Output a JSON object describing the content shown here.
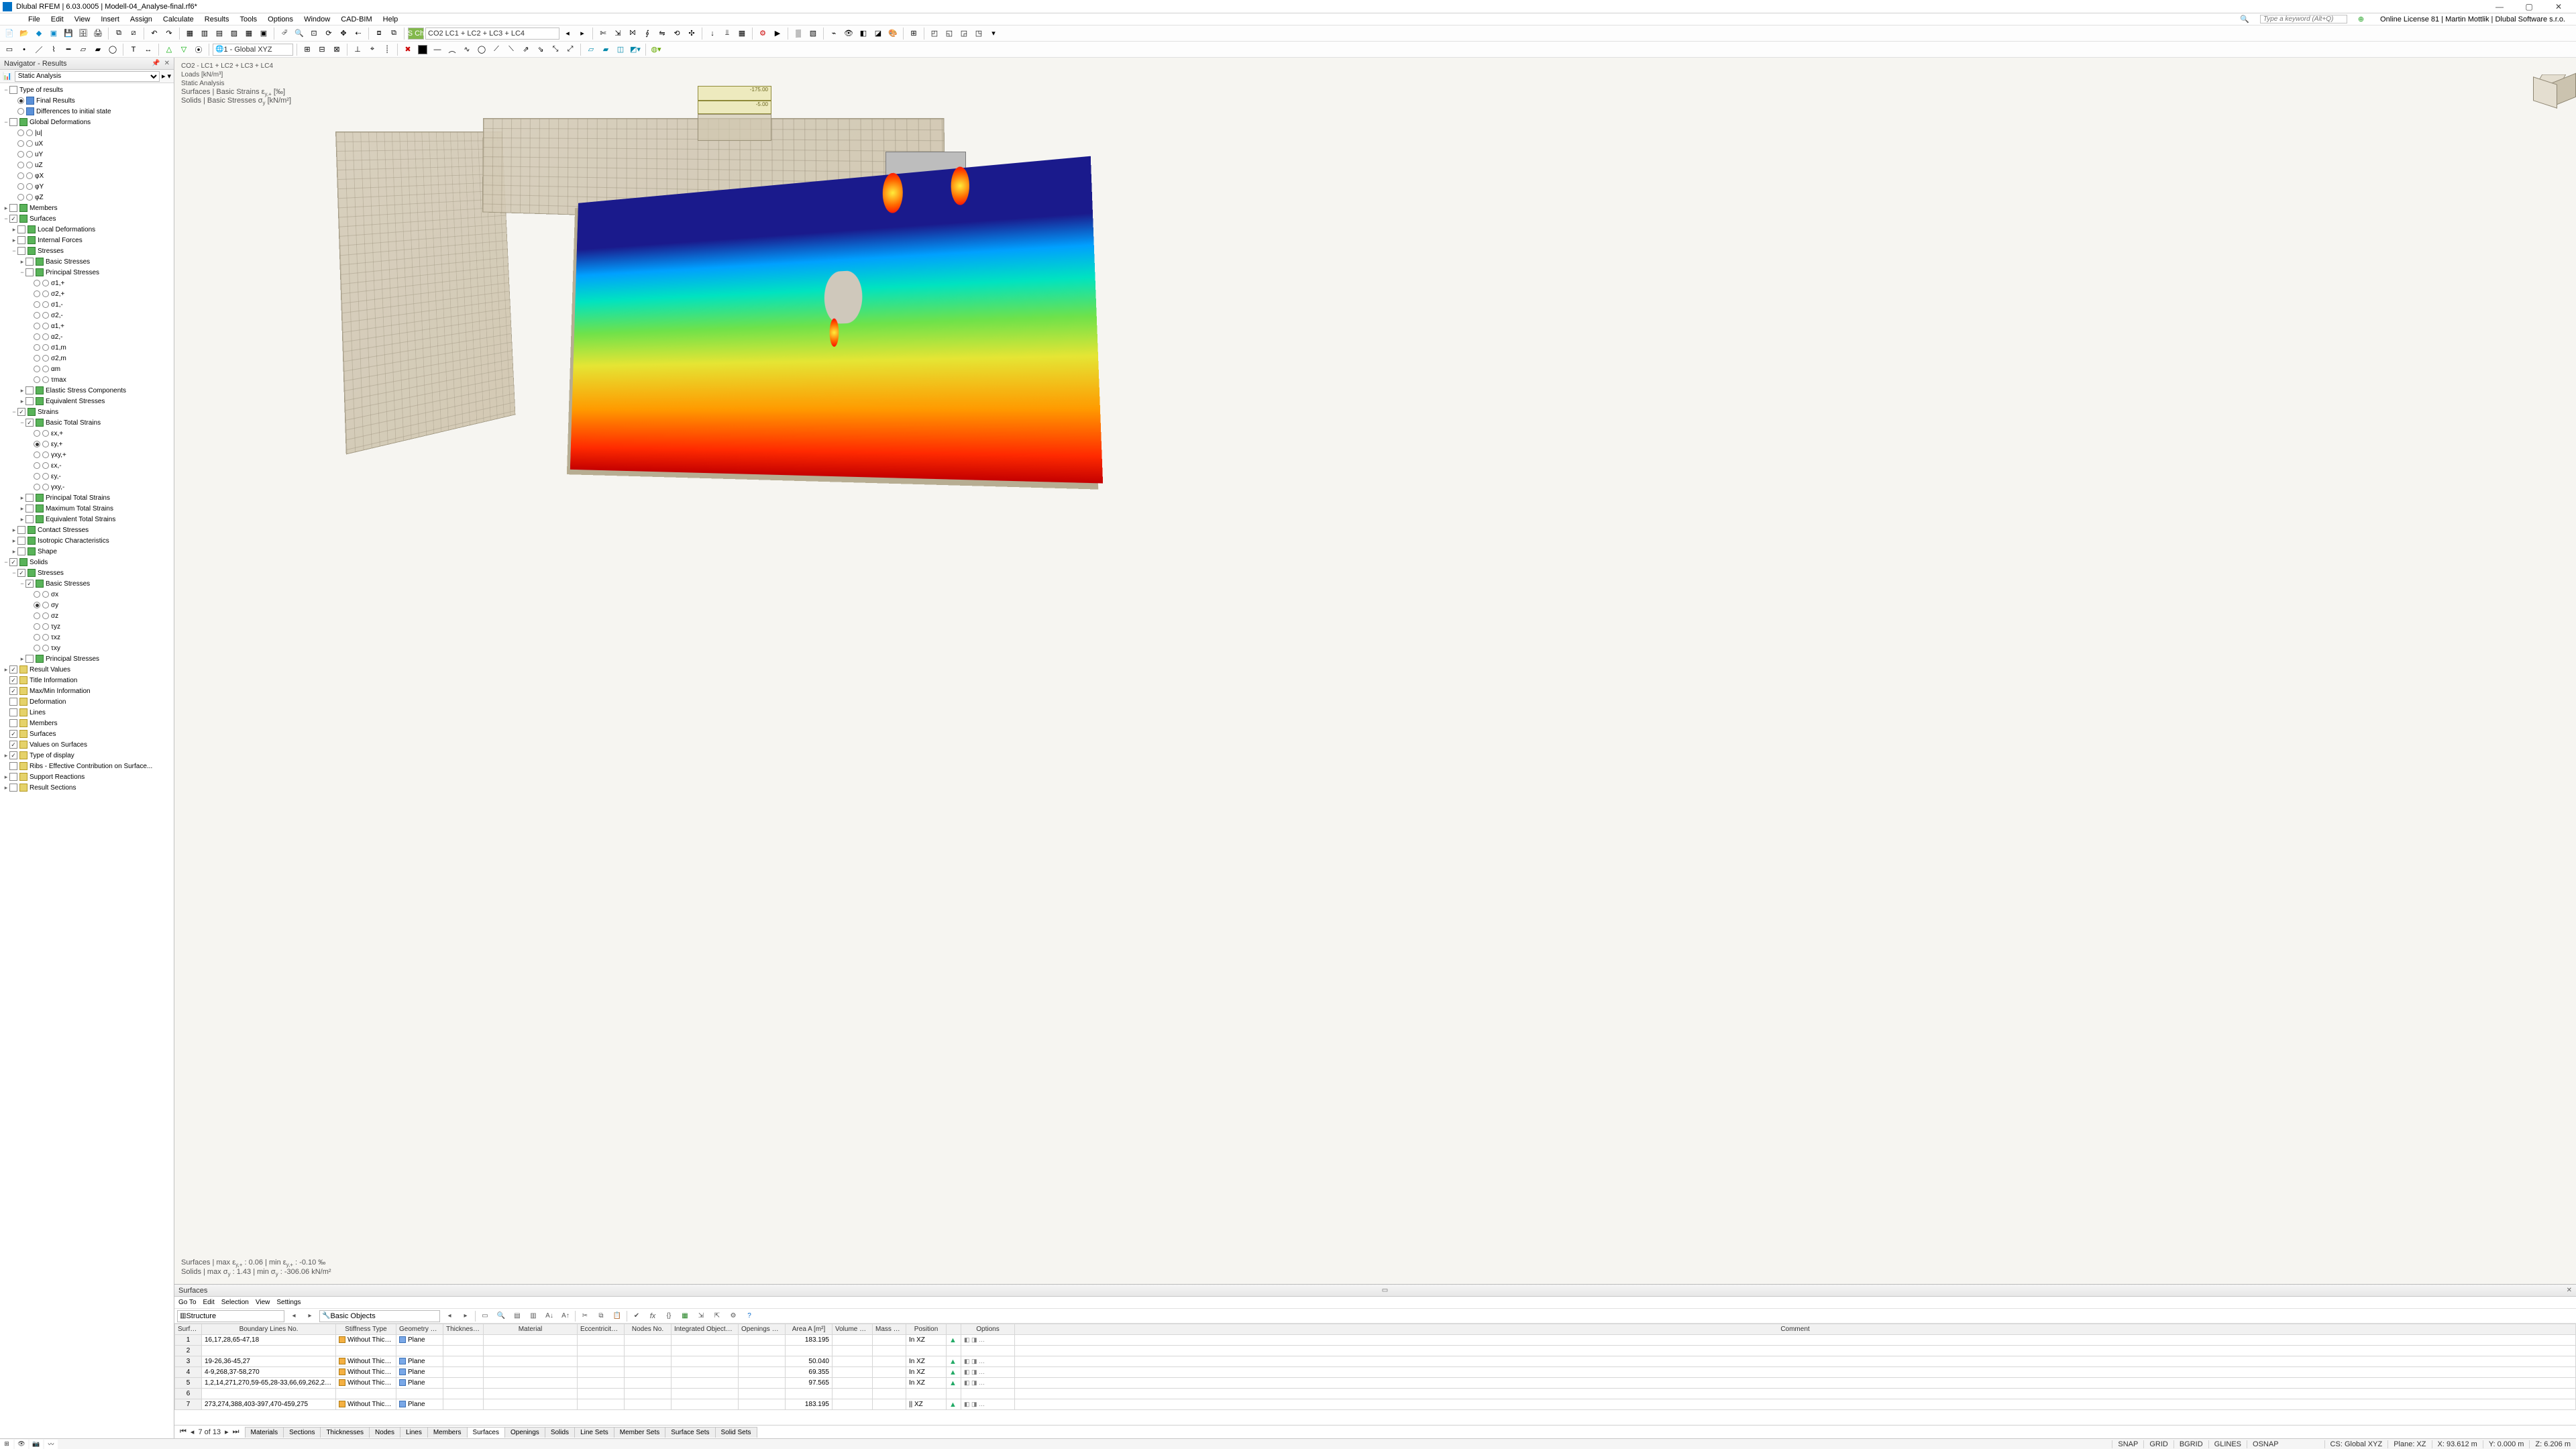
{
  "titlebar": {
    "text": "Dlubal RFEM | 6.03.0005 | Modell-04_Analyse-final.rf6*"
  },
  "menubar": {
    "items": [
      "File",
      "Edit",
      "View",
      "Insert",
      "Assign",
      "Calculate",
      "Results",
      "Tools",
      "Options",
      "Window",
      "CAD-BIM",
      "Help"
    ],
    "search_placeholder": "Type a keyword (Alt+Q)",
    "license": "Online License 81 | Martin Mottlik | Dlubal Software s.r.o."
  },
  "toolbar1": {
    "combo_loadcase_prefix": "S Ch",
    "combo_loadcase": "CO2   LC1 + LC2 + LC3 + LC4"
  },
  "toolbar2": {
    "combo_cs": "1 - Global XYZ"
  },
  "navigator": {
    "title": "Navigator - Results",
    "analysis_type": "Static Analysis",
    "tree_headers": {
      "type_of_results": "Type of results",
      "final_results": "Final Results",
      "diff_initial": "Differences to initial state",
      "global_def": "Global Deformations",
      "members": "Members",
      "surfaces": "Surfaces",
      "local_def": "Local Deformations",
      "internal_forces": "Internal Forces",
      "stresses": "Stresses",
      "basic_stresses": "Basic Stresses",
      "principal_stresses": "Principal Stresses",
      "elastic": "Elastic Stress Components",
      "equiv_stresses": "Equivalent Stresses",
      "strains": "Strains",
      "basic_total_strains": "Basic Total Strains",
      "principal_total_strains": "Principal Total Strains",
      "max_total_strains": "Maximum Total Strains",
      "equiv_total_strains": "Equivalent Total Strains",
      "contact_stresses": "Contact Stresses",
      "isotropic": "Isotropic Characteristics",
      "shape": "Shape",
      "solids": "Solids",
      "solid_stresses": "Stresses",
      "solid_basic_stresses": "Basic Stresses",
      "solid_principal_stresses": "Principal Stresses",
      "result_values": "Result Values",
      "title_info": "Title Information",
      "maxmin": "Max/Min Information",
      "deformation": "Deformation",
      "lines": "Lines",
      "members2": "Members",
      "surfaces2": "Surfaces",
      "values_on_surfaces": "Values on Surfaces",
      "type_of_display": "Type of display",
      "ribs": "Ribs - Effective Contribution on Surface...",
      "support_reactions": "Support Reactions",
      "result_sections": "Result Sections"
    },
    "sigma_items": [
      "σ1,+",
      "σ2,+",
      "σ1,-",
      "σ2,-",
      "α1,+",
      "α2,-",
      "σ1,m",
      "σ2,m",
      "αm",
      "τmax"
    ],
    "strain_items": [
      "εx,+",
      "εy,+",
      "γxy,+",
      "εx,-",
      "εy,-",
      "γxy,-"
    ],
    "solid_sigma": [
      "σx",
      "σy",
      "σz",
      "τyz",
      "τxz",
      "τxy"
    ],
    "u_items": [
      "|u|",
      "uX",
      "uY",
      "uZ",
      "φX",
      "φY",
      "φZ"
    ]
  },
  "viewport": {
    "line1": "CO2 - LC1 + LC2 + LC3 + LC4",
    "line2": "Loads [kN/m³]",
    "line3": "Static Analysis",
    "line4_a": "Surfaces | Basic Strains ε",
    "line4_b": "y,+",
    "line4_c": " [‰]",
    "line5_a": "Solids | Basic Stresses σ",
    "line5_b": "y",
    "line5_c": " [kN/m²]",
    "load_label_top": "-175.00",
    "load_label_bot": "-5.00",
    "bottomtext1_a": "Surfaces | max ε",
    "bottomtext1_b": "y,+",
    "bottomtext1_c": " : 0.06 | min ε",
    "bottomtext1_d": "y,+",
    "bottomtext1_e": " : -0.10 ‰",
    "bottomtext2_a": "Solids | max σ",
    "bottomtext2_b": "y",
    "bottomtext2_c": " : 1.43 | min σ",
    "bottomtext2_d": "y",
    "bottomtext2_e": " : -306.06 kN/m²"
  },
  "bottom_panel": {
    "title": "Surfaces",
    "menu": [
      "Go To",
      "Edit",
      "Selection",
      "View",
      "Settings"
    ],
    "combo_left": "Structure",
    "combo_right": "Basic Objects",
    "columns": [
      "Surface No.",
      "Boundary Lines No.",
      "Stiffness Type",
      "Geometry Type",
      "Thickness No.",
      "Material",
      "Eccentricity No.",
      "Nodes No.",
      "Integrated Objects Lines No.",
      "Openings No.",
      "Area A [m²]",
      "Volume V [m³]",
      "Mass M [t]",
      "Position",
      "",
      "Options",
      "Comment"
    ],
    "rows": [
      {
        "no": "1",
        "b": "16,17,28,65-47,18",
        "stiff": "Without Thickn...",
        "geo": "Plane",
        "area": "183.195",
        "pos": "In XZ"
      },
      {
        "no": "2",
        "b": "",
        "stiff": "",
        "geo": "",
        "area": "",
        "pos": ""
      },
      {
        "no": "3",
        "b": "19-26,36-45,27",
        "stiff": "Without Thickn...",
        "geo": "Plane",
        "area": "50.040",
        "pos": "In XZ"
      },
      {
        "no": "4",
        "b": "4-9,268,37-58,270",
        "stiff": "Without Thickn...",
        "geo": "Plane",
        "area": "69.355",
        "pos": "In XZ"
      },
      {
        "no": "5",
        "b": "1,2,14,271,270,59-65,28-33,66,69,262,265,2...",
        "stiff": "Without Thickn...",
        "geo": "Plane",
        "area": "97.565",
        "pos": "In XZ"
      },
      {
        "no": "6",
        "b": "",
        "stiff": "",
        "geo": "",
        "area": "",
        "pos": ""
      },
      {
        "no": "7",
        "b": "273,274,388,403-397,470-459,275",
        "stiff": "Without Thickn...",
        "geo": "Plane",
        "area": "183.195",
        "pos": "|| XZ"
      }
    ],
    "pager": "7 of 13",
    "bottom_tabs": [
      "Materials",
      "Sections",
      "Thicknesses",
      "Nodes",
      "Lines",
      "Members",
      "Surfaces",
      "Openings",
      "Solids",
      "Line Sets",
      "Member Sets",
      "Surface Sets",
      "Solid Sets"
    ],
    "active_tab": "Surfaces"
  },
  "statusbar": {
    "snap": "SNAP",
    "grid": "GRID",
    "bgrid": "BGRID",
    "glines": "GLINES",
    "osnap": "OSNAP",
    "cs": "CS: Global XYZ",
    "plane": "Plane: XZ",
    "x": "X: 93.612 m",
    "y": "Y: 0.000 m",
    "z": "Z: 6.206 m"
  }
}
